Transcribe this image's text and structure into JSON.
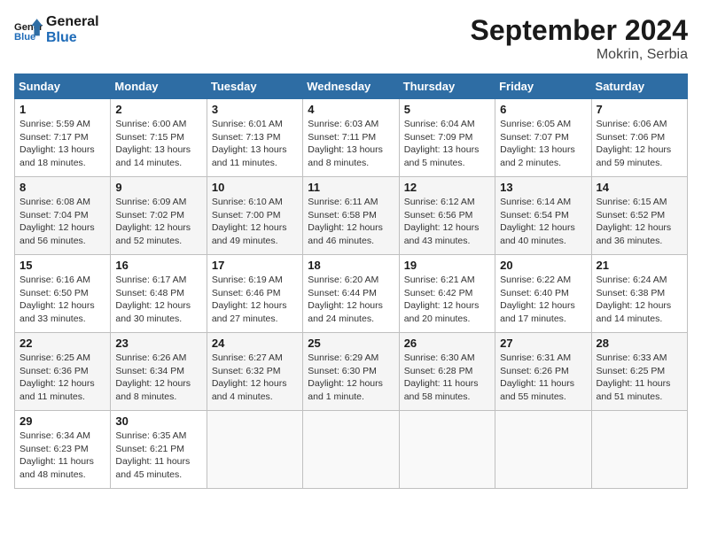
{
  "header": {
    "logo_line1": "General",
    "logo_line2": "Blue",
    "month_year": "September 2024",
    "location": "Mokrin, Serbia"
  },
  "weekdays": [
    "Sunday",
    "Monday",
    "Tuesday",
    "Wednesday",
    "Thursday",
    "Friday",
    "Saturday"
  ],
  "weeks": [
    [
      {
        "day": "1",
        "info": "Sunrise: 5:59 AM\nSunset: 7:17 PM\nDaylight: 13 hours and 18 minutes."
      },
      {
        "day": "2",
        "info": "Sunrise: 6:00 AM\nSunset: 7:15 PM\nDaylight: 13 hours and 14 minutes."
      },
      {
        "day": "3",
        "info": "Sunrise: 6:01 AM\nSunset: 7:13 PM\nDaylight: 13 hours and 11 minutes."
      },
      {
        "day": "4",
        "info": "Sunrise: 6:03 AM\nSunset: 7:11 PM\nDaylight: 13 hours and 8 minutes."
      },
      {
        "day": "5",
        "info": "Sunrise: 6:04 AM\nSunset: 7:09 PM\nDaylight: 13 hours and 5 minutes."
      },
      {
        "day": "6",
        "info": "Sunrise: 6:05 AM\nSunset: 7:07 PM\nDaylight: 13 hours and 2 minutes."
      },
      {
        "day": "7",
        "info": "Sunrise: 6:06 AM\nSunset: 7:06 PM\nDaylight: 12 hours and 59 minutes."
      }
    ],
    [
      {
        "day": "8",
        "info": "Sunrise: 6:08 AM\nSunset: 7:04 PM\nDaylight: 12 hours and 56 minutes."
      },
      {
        "day": "9",
        "info": "Sunrise: 6:09 AM\nSunset: 7:02 PM\nDaylight: 12 hours and 52 minutes."
      },
      {
        "day": "10",
        "info": "Sunrise: 6:10 AM\nSunset: 7:00 PM\nDaylight: 12 hours and 49 minutes."
      },
      {
        "day": "11",
        "info": "Sunrise: 6:11 AM\nSunset: 6:58 PM\nDaylight: 12 hours and 46 minutes."
      },
      {
        "day": "12",
        "info": "Sunrise: 6:12 AM\nSunset: 6:56 PM\nDaylight: 12 hours and 43 minutes."
      },
      {
        "day": "13",
        "info": "Sunrise: 6:14 AM\nSunset: 6:54 PM\nDaylight: 12 hours and 40 minutes."
      },
      {
        "day": "14",
        "info": "Sunrise: 6:15 AM\nSunset: 6:52 PM\nDaylight: 12 hours and 36 minutes."
      }
    ],
    [
      {
        "day": "15",
        "info": "Sunrise: 6:16 AM\nSunset: 6:50 PM\nDaylight: 12 hours and 33 minutes."
      },
      {
        "day": "16",
        "info": "Sunrise: 6:17 AM\nSunset: 6:48 PM\nDaylight: 12 hours and 30 minutes."
      },
      {
        "day": "17",
        "info": "Sunrise: 6:19 AM\nSunset: 6:46 PM\nDaylight: 12 hours and 27 minutes."
      },
      {
        "day": "18",
        "info": "Sunrise: 6:20 AM\nSunset: 6:44 PM\nDaylight: 12 hours and 24 minutes."
      },
      {
        "day": "19",
        "info": "Sunrise: 6:21 AM\nSunset: 6:42 PM\nDaylight: 12 hours and 20 minutes."
      },
      {
        "day": "20",
        "info": "Sunrise: 6:22 AM\nSunset: 6:40 PM\nDaylight: 12 hours and 17 minutes."
      },
      {
        "day": "21",
        "info": "Sunrise: 6:24 AM\nSunset: 6:38 PM\nDaylight: 12 hours and 14 minutes."
      }
    ],
    [
      {
        "day": "22",
        "info": "Sunrise: 6:25 AM\nSunset: 6:36 PM\nDaylight: 12 hours and 11 minutes."
      },
      {
        "day": "23",
        "info": "Sunrise: 6:26 AM\nSunset: 6:34 PM\nDaylight: 12 hours and 8 minutes."
      },
      {
        "day": "24",
        "info": "Sunrise: 6:27 AM\nSunset: 6:32 PM\nDaylight: 12 hours and 4 minutes."
      },
      {
        "day": "25",
        "info": "Sunrise: 6:29 AM\nSunset: 6:30 PM\nDaylight: 12 hours and 1 minute."
      },
      {
        "day": "26",
        "info": "Sunrise: 6:30 AM\nSunset: 6:28 PM\nDaylight: 11 hours and 58 minutes."
      },
      {
        "day": "27",
        "info": "Sunrise: 6:31 AM\nSunset: 6:26 PM\nDaylight: 11 hours and 55 minutes."
      },
      {
        "day": "28",
        "info": "Sunrise: 6:33 AM\nSunset: 6:25 PM\nDaylight: 11 hours and 51 minutes."
      }
    ],
    [
      {
        "day": "29",
        "info": "Sunrise: 6:34 AM\nSunset: 6:23 PM\nDaylight: 11 hours and 48 minutes."
      },
      {
        "day": "30",
        "info": "Sunrise: 6:35 AM\nSunset: 6:21 PM\nDaylight: 11 hours and 45 minutes."
      },
      null,
      null,
      null,
      null,
      null
    ]
  ]
}
